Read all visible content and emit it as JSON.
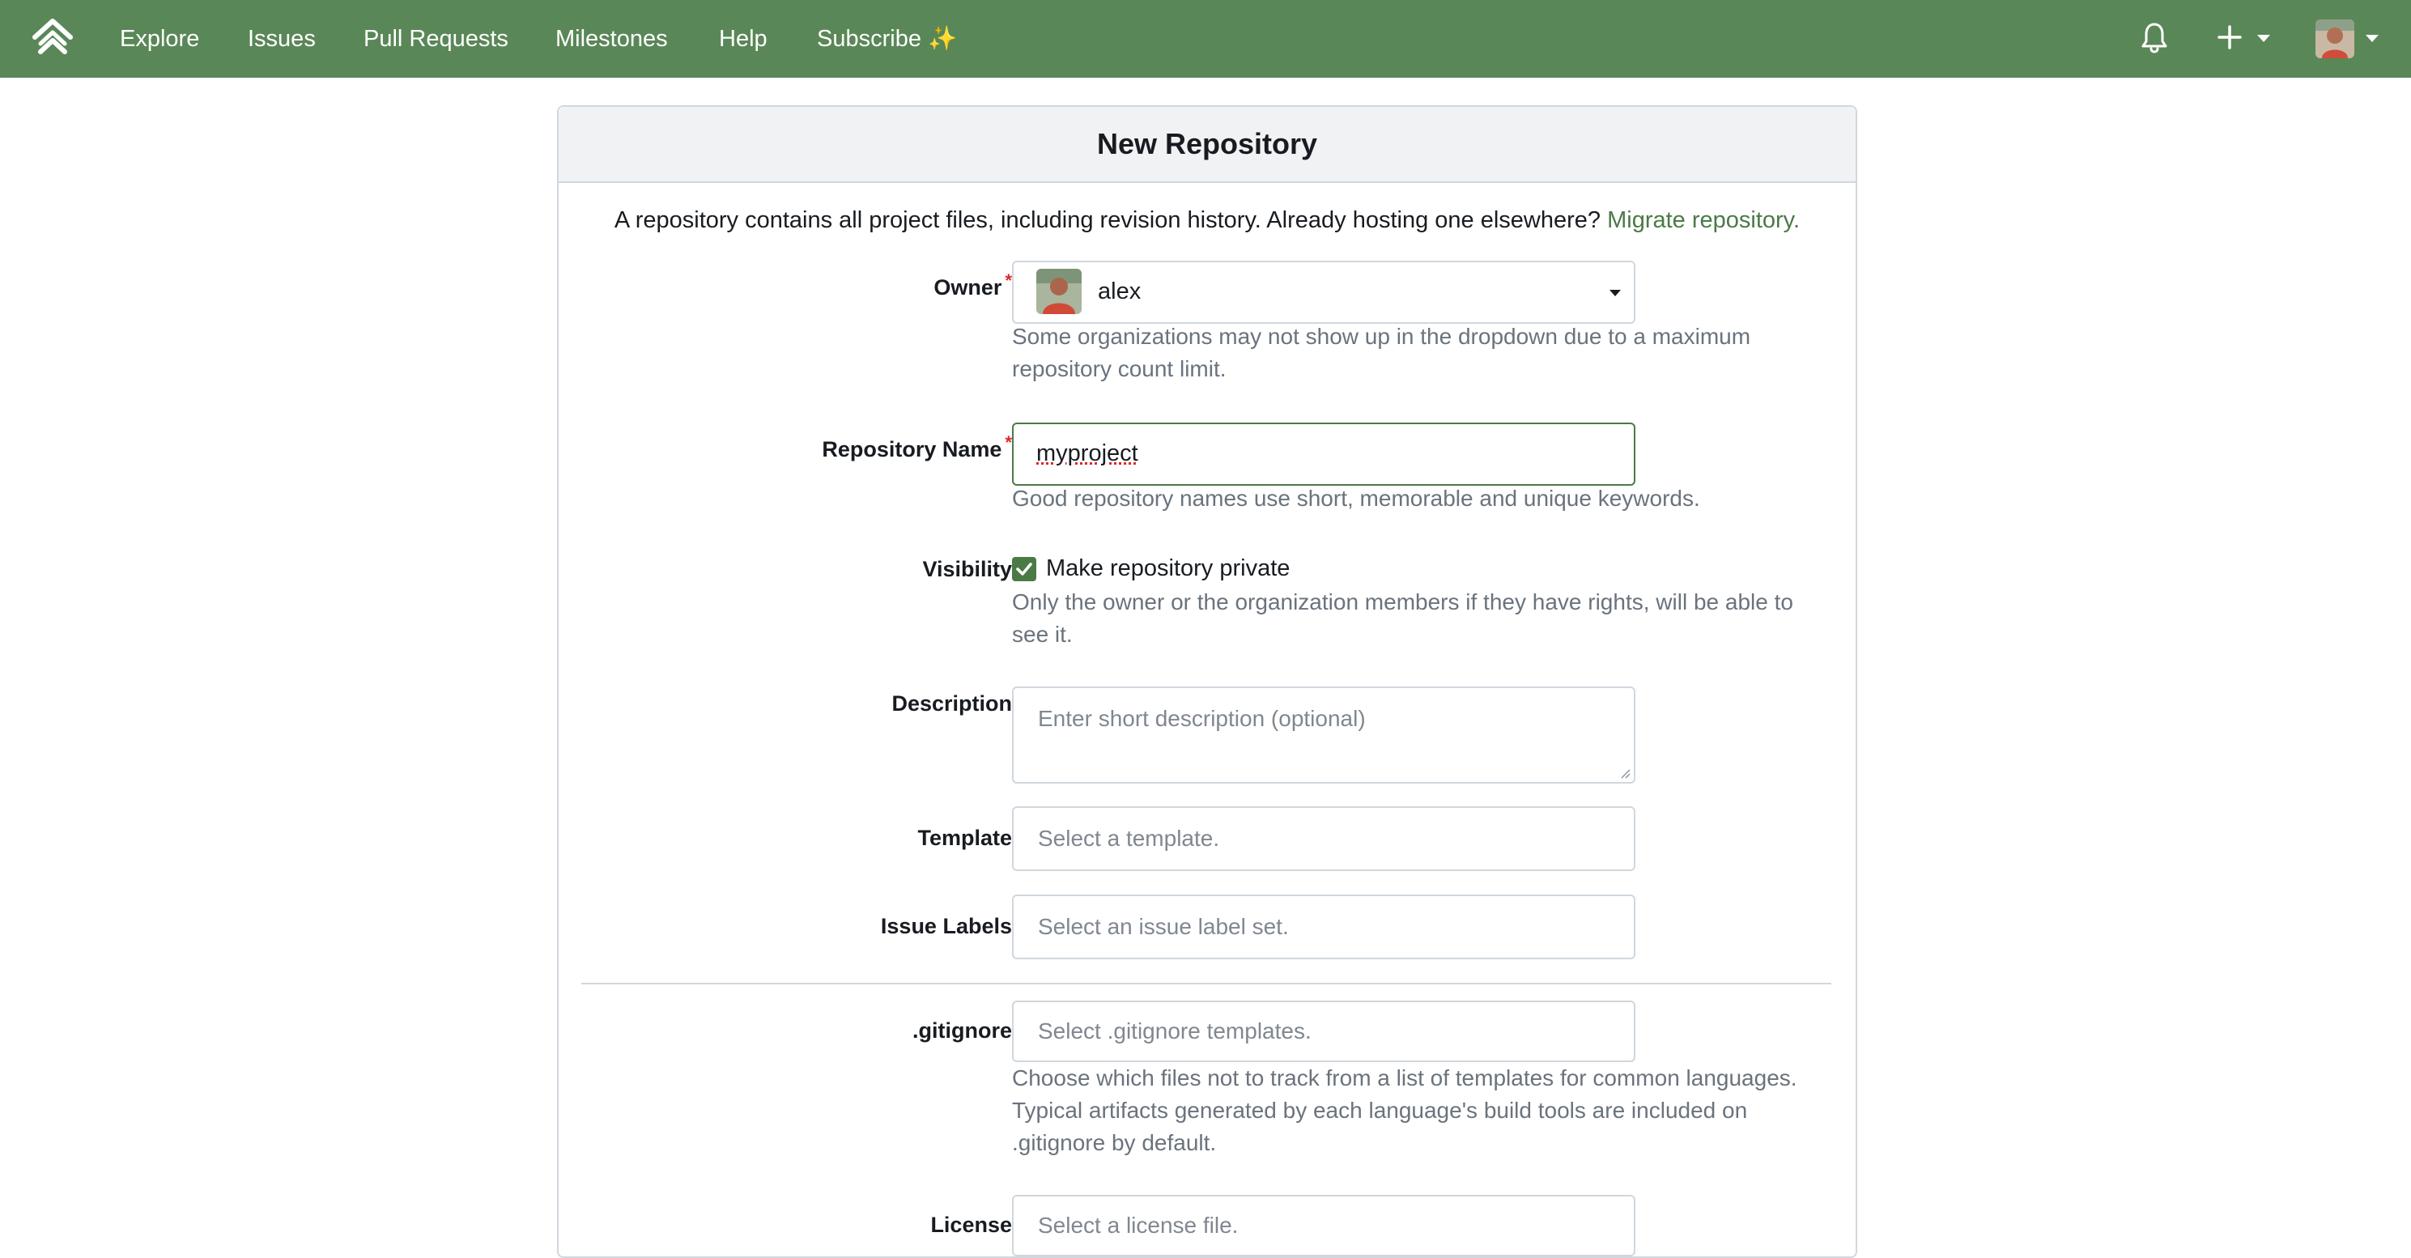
{
  "nav": {
    "logo_icon": "forgejo-logo-icon",
    "items": [
      "Explore",
      "Issues",
      "Pull Requests",
      "Milestones",
      "Help",
      "Subscribe ✨"
    ],
    "right_icons": [
      "bell-icon",
      "plus-icon",
      "avatar"
    ]
  },
  "colors": {
    "navbar": "#5a8757",
    "accent": "#4b7a47",
    "required": "#db2828"
  },
  "card": {
    "title": "New Repository",
    "intro_text": "A repository contains all project files, including revision history. Already hosting one elsewhere?",
    "intro_link": "Migrate repository."
  },
  "form": {
    "owner": {
      "label": "Owner",
      "value": "alex",
      "help": "Some organizations may not show up in the dropdown due to a maximum repository count limit."
    },
    "repo_name": {
      "label": "Repository Name",
      "value": "myproject",
      "help": "Good repository names use short, memorable and unique keywords."
    },
    "visibility": {
      "label": "Visibility",
      "checkbox_label": "Make repository private",
      "checked": true,
      "help": "Only the owner or the organization members if they have rights, will be able to see it."
    },
    "description": {
      "label": "Description",
      "placeholder": "Enter short description (optional)"
    },
    "template": {
      "label": "Template",
      "placeholder": "Select a template."
    },
    "issue_labels": {
      "label": "Issue Labels",
      "placeholder": "Select an issue label set."
    },
    "gitignore": {
      "label": ".gitignore",
      "placeholder": "Select .gitignore templates.",
      "help": "Choose which files not to track from a list of templates for common languages. Typical artifacts generated by each language's build tools are included on .gitignore by default."
    },
    "license": {
      "label": "License",
      "placeholder": "Select a license file."
    }
  }
}
